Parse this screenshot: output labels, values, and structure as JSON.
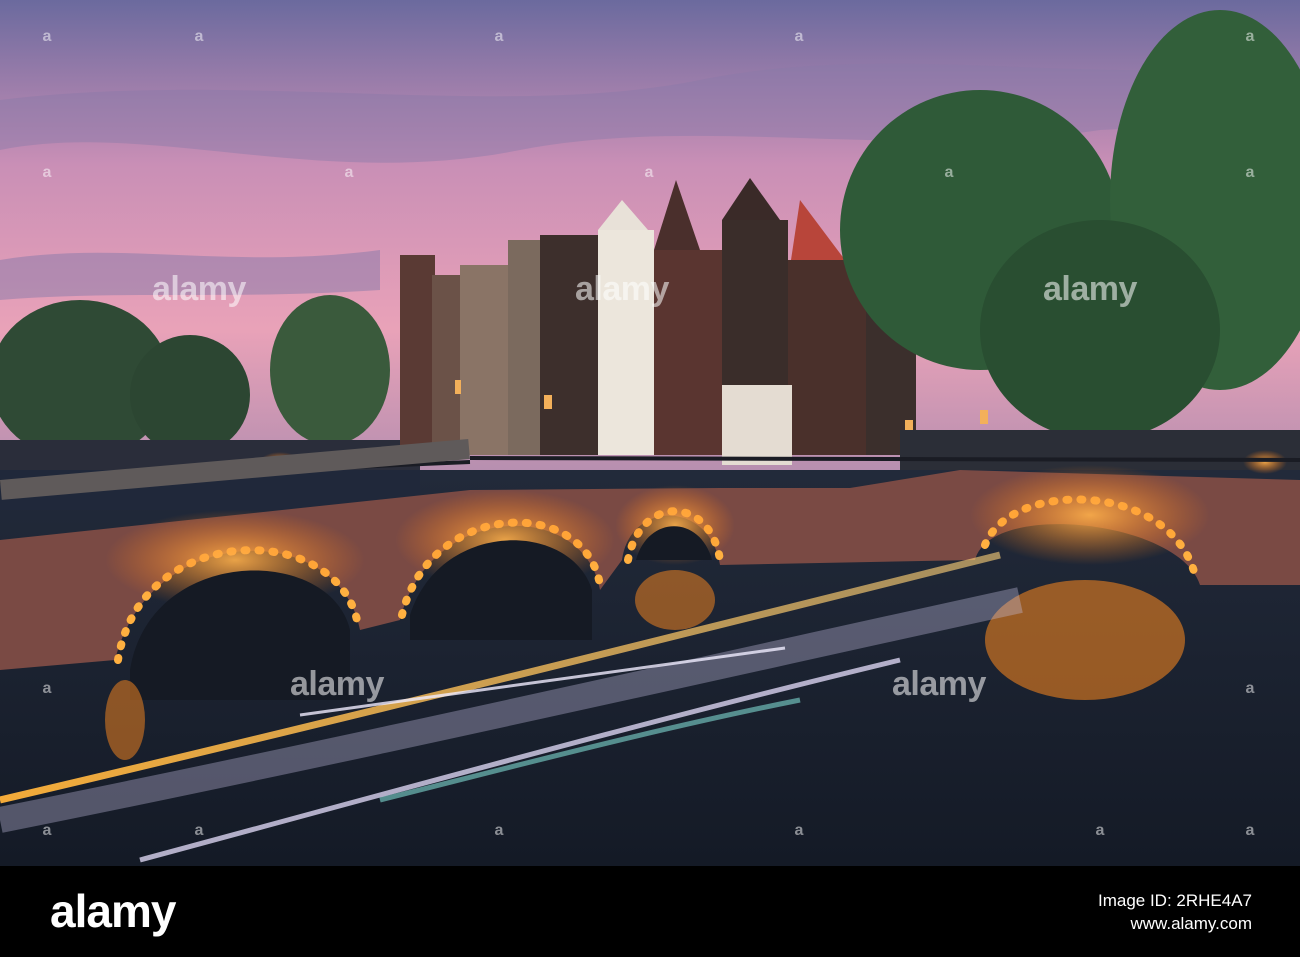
{
  "image": {
    "subject": "Canal bridge at dusk",
    "colors": {
      "sky_top": "#6f6a9c",
      "sky_pink": "#e89ab8",
      "water": "#1c2433",
      "brick": "#7a4a44",
      "light_glow": "#ff8a1e",
      "footer_bg": "#000000"
    }
  },
  "watermarks": {
    "center": "alamy",
    "left": "alamy",
    "right": "alamy",
    "lower": "alamy",
    "lower_right": "alamy",
    "small_mark": "a"
  },
  "footer": {
    "logo": "alamy",
    "image_id": "Image ID: 2RHE4A7",
    "url": "www.alamy.com"
  }
}
